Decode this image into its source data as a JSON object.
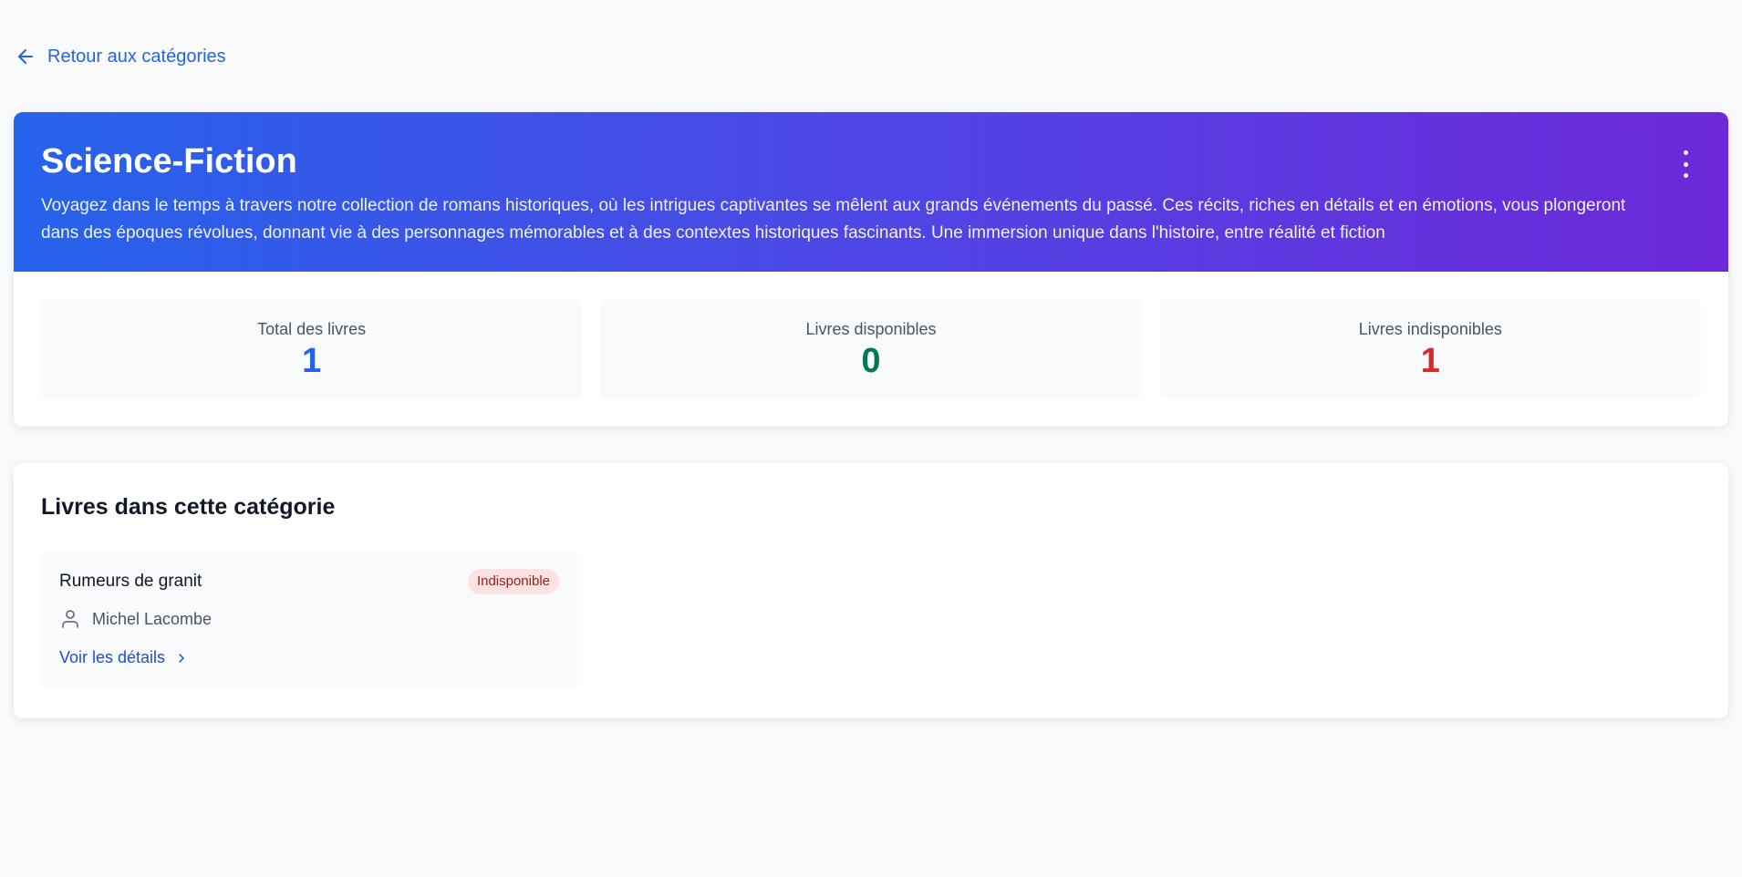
{
  "navigation": {
    "back_label": "Retour aux catégories"
  },
  "category": {
    "title": "Science-Fiction",
    "description": "Voyagez dans le temps à travers notre collection de romans historiques, où les intrigues captivantes se mêlent aux grands événements du passé. Ces récits, riches en détails et en émotions, vous plongeront dans des époques révolues, donnant vie à des personnages mémorables et à des contextes historiques fascinants. Une immersion unique dans l'histoire, entre réalité et fiction",
    "menu_icon": "more-vertical-icon",
    "header_gradient": [
      "#2563eb",
      "#6d28d9"
    ]
  },
  "stats": [
    {
      "label": "Total des livres",
      "value": "1",
      "color": "#2563eb"
    },
    {
      "label": "Livres disponibles",
      "value": "0",
      "color": "#047857"
    },
    {
      "label": "Livres indisponibles",
      "value": "1",
      "color": "#dc2626"
    }
  ],
  "books_section": {
    "title": "Livres dans cette catégorie",
    "books": [
      {
        "title": "Rumeurs de granit",
        "status": "Indisponible",
        "status_color": "#991b1b",
        "author": "Michel Lacombe",
        "author_icon": "user-icon",
        "details_label": "Voir les détails",
        "details_icon": "chevron-right-icon"
      }
    ]
  }
}
